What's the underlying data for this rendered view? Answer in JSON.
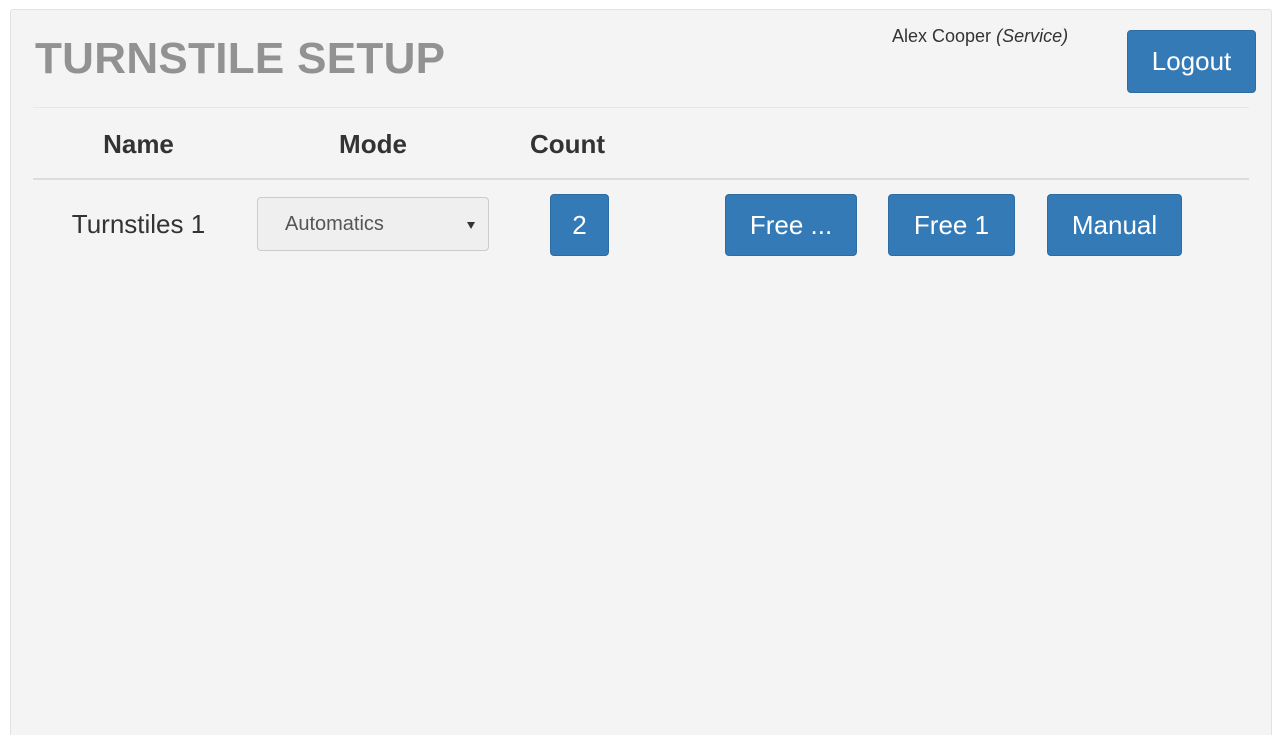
{
  "header": {
    "title": "TURNSTILE SETUP",
    "user_name": "Alex Cooper",
    "user_role": "(Service)",
    "logout_label": "Logout"
  },
  "table": {
    "columns": [
      "Name",
      "Mode",
      "Count"
    ],
    "rows": [
      {
        "name": "Turnstiles 1",
        "mode": "Automatics",
        "count": "2",
        "actions": [
          "Free ...",
          "Free 1",
          "Manual"
        ]
      }
    ]
  },
  "colors": {
    "primary_button": "#337ab7",
    "title_gray": "#929292",
    "panel_background": "#f4f4f4"
  },
  "icons": {
    "select_arrow": "caret-down-icon"
  }
}
